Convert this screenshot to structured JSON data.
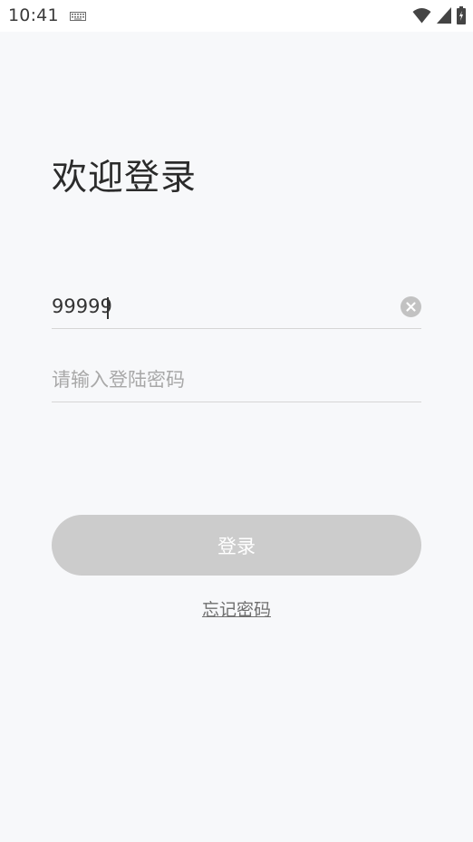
{
  "status_bar": {
    "time": "10:41",
    "icons": [
      "keyboard-icon",
      "wifi-icon",
      "signal-icon",
      "battery-icon"
    ]
  },
  "login": {
    "title": "欢迎登录",
    "phone_value": "99999",
    "password_placeholder": "请输入登陆密码",
    "login_button_label": "登录",
    "forgot_password_label": "忘记密码"
  },
  "colors": {
    "background": "#f7f8fa",
    "button_disabled": "#cccccc",
    "clear_icon": "#c2c2c2"
  }
}
